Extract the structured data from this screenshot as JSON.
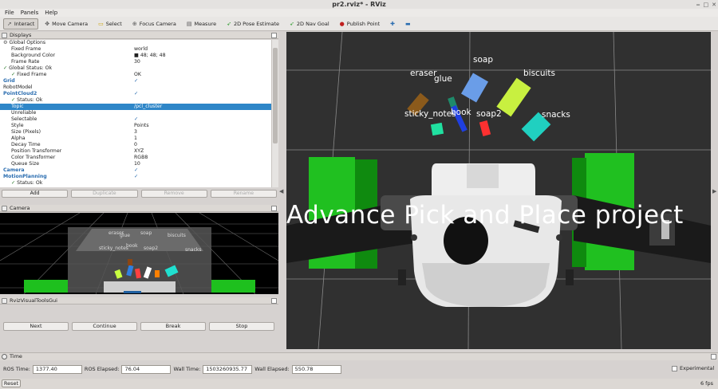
{
  "window": {
    "title": "pr2.rviz* - RViz"
  },
  "menu": [
    "File",
    "Panels",
    "Help"
  ],
  "toolbar": [
    {
      "label": "Interact",
      "icon": "cursor-icon",
      "active": true
    },
    {
      "label": "Move Camera",
      "icon": "move-icon",
      "active": false
    },
    {
      "label": "Select",
      "icon": "select-icon",
      "active": false
    },
    {
      "label": "Focus Camera",
      "icon": "focus-icon",
      "active": false
    },
    {
      "label": "Measure",
      "icon": "ruler-icon",
      "active": false
    },
    {
      "label": "2D Pose Estimate",
      "icon": "pose-arrow-icon",
      "active": false
    },
    {
      "label": "2D Nav Goal",
      "icon": "nav-arrow-icon",
      "active": false
    },
    {
      "label": "Publish Point",
      "icon": "pin-icon",
      "active": false
    }
  ],
  "displays": {
    "title": "Displays",
    "rows": [
      {
        "k": "Global Options",
        "v": "",
        "indent": 0,
        "icon": "gear"
      },
      {
        "k": "Fixed Frame",
        "v": "world",
        "indent": 1
      },
      {
        "k": "Background Color",
        "v": "■ 48; 48; 48",
        "indent": 1
      },
      {
        "k": "Frame Rate",
        "v": "30",
        "indent": 1
      },
      {
        "k": "Global Status: Ok",
        "v": "",
        "indent": 0,
        "icon": "check"
      },
      {
        "k": "Fixed Frame",
        "v": "OK",
        "indent": 1,
        "icon": "check"
      },
      {
        "k": "Grid",
        "v": "✓",
        "indent": 0,
        "bold": true
      },
      {
        "k": "RobotModel",
        "v": "",
        "indent": 0
      },
      {
        "k": "PointCloud2",
        "v": "✓",
        "indent": 0,
        "bold": true
      },
      {
        "k": "Status: Ok",
        "v": "",
        "indent": 1,
        "icon": "check"
      },
      {
        "k": "Topic",
        "v": "/pcl_cluster",
        "indent": 1,
        "sel": true
      },
      {
        "k": "Unreliable",
        "v": "",
        "indent": 1
      },
      {
        "k": "Selectable",
        "v": "✓",
        "indent": 1
      },
      {
        "k": "Style",
        "v": "Points",
        "indent": 1
      },
      {
        "k": "Size (Pixels)",
        "v": "3",
        "indent": 1
      },
      {
        "k": "Alpha",
        "v": "1",
        "indent": 1
      },
      {
        "k": "Decay Time",
        "v": "0",
        "indent": 1
      },
      {
        "k": "Position Transformer",
        "v": "XYZ",
        "indent": 1
      },
      {
        "k": "Color Transformer",
        "v": "RGB8",
        "indent": 1
      },
      {
        "k": "Queue Size",
        "v": "10",
        "indent": 1
      },
      {
        "k": "Camera",
        "v": "✓",
        "indent": 0,
        "bold": true
      },
      {
        "k": "MotionPlanning",
        "v": "✓",
        "indent": 0,
        "bold": true
      },
      {
        "k": "Status: Ok",
        "v": "",
        "indent": 1,
        "icon": "check"
      }
    ],
    "buttons": [
      {
        "label": "Add",
        "enabled": true
      },
      {
        "label": "Duplicate",
        "enabled": false
      },
      {
        "label": "Remove",
        "enabled": false
      },
      {
        "label": "Rename",
        "enabled": false
      }
    ]
  },
  "camera_panel": {
    "title": "Camera"
  },
  "rviz_visual_tools": {
    "title": "RvizVisualToolsGui",
    "buttons": [
      "Next",
      "Continue",
      "Break",
      "Stop"
    ]
  },
  "viewport": {
    "overlay_text": "Advance  Pick  and  Place  project",
    "labels": [
      "soap",
      "eraser",
      "glue",
      "biscuits",
      "sticky_notes",
      "book",
      "soap2",
      "snacks"
    ]
  },
  "camera_labels": [
    "soap",
    "eraser",
    "glue",
    "biscuits",
    "sticky_notes",
    "book",
    "soap2",
    "snacks"
  ],
  "time": {
    "title": "Time",
    "ros_time_label": "ROS Time:",
    "ros_time": "1377.40",
    "ros_elapsed_label": "ROS Elapsed:",
    "ros_elapsed": "76.04",
    "wall_time_label": "Wall Time:",
    "wall_time": "1503260935.77",
    "wall_elapsed_label": "Wall Elapsed:",
    "wall_elapsed": "550.78",
    "experimental_label": "Experimental"
  },
  "status": {
    "reset_label": "Reset",
    "fps": "6 fps"
  }
}
